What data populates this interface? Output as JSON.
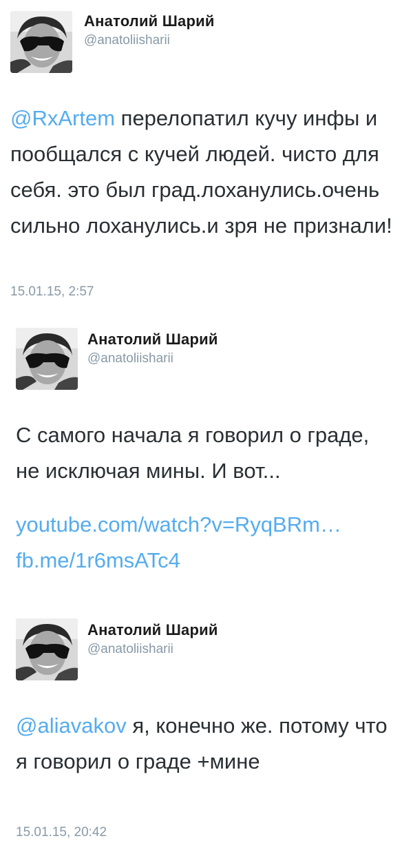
{
  "tweets": [
    {
      "author_name": "Анатолий Шарий",
      "author_handle": "@anatoliisharii",
      "mention": "@RxArtem",
      "text": " перелопатил кучу инфы и пообщался с кучей людей. чисто для себя. это был град.лоханулись.очень сильно лоханулись.и зря не признали!",
      "timestamp": "15.01.15, 2:57"
    },
    {
      "author_name": "Анатолий Шарий",
      "author_handle": "@anatoliisharii",
      "text": "С самого начала я говорил о граде, не исключая мины. И вот...",
      "link1": "youtube.com/watch?v=RyqBRm…",
      "link2": "fb.me/1r6msATc4"
    },
    {
      "author_name": "Анатолий Шарий",
      "author_handle": "@anatoliisharii",
      "mention": "@aliavakov",
      "text": " я, конечно же. потому что я говорил о граде +мине",
      "timestamp": "15.01.15, 20:42"
    }
  ],
  "colors": {
    "link": "#55acee",
    "text": "#292f33",
    "meta": "#8899a6"
  },
  "icons": {
    "avatar": "profile-photo"
  }
}
